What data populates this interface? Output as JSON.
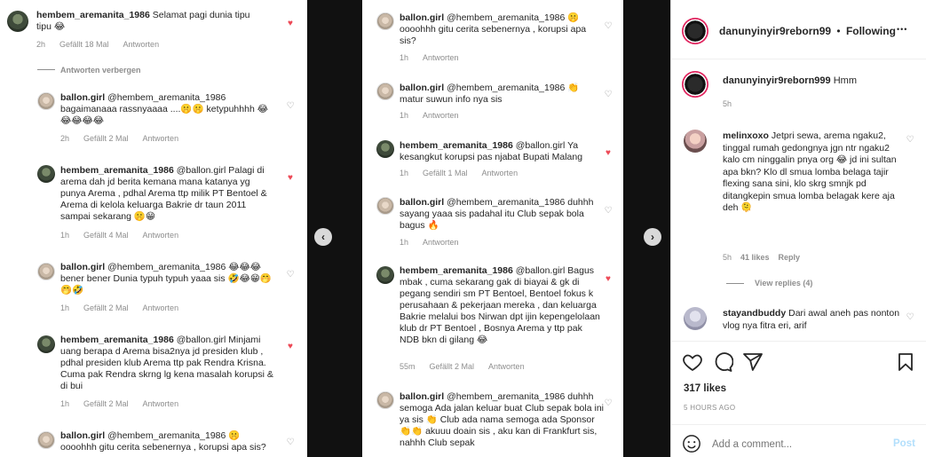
{
  "left": {
    "comments": [
      {
        "user": "hembem_aremanita_1986",
        "text": "Selamat pagi dunia tipu tipu 😂",
        "time": "2h",
        "likes": "Gefällt 18 Mal",
        "reply": "Antworten",
        "liked": true
      },
      {
        "user": "ballon.girl",
        "text": "@hembem_aremanita_1986 bagaimanaaa rassnyaaaa ....🤫🤫 ketypuhhhh 😂😂😂😂😂",
        "time": "2h",
        "likes": "Gefällt 2 Mal",
        "reply": "Antworten",
        "liked": false
      },
      {
        "user": "hembem_aremanita_1986",
        "text": "@ballon.girl Palagi di arema dah jd berita kemana mana katanya yg punya Arema , pdhal Arema ttp milik PT Bentoel & Arema di kelola keluarga Bakrie dr taun 2011 sampai sekarang 🤫😁",
        "time": "1h",
        "likes": "Gefällt 4 Mal",
        "reply": "Antworten",
        "liked": true
      },
      {
        "user": "ballon.girl",
        "text": "@hembem_aremanita_1986 😂😂😂 bener bener Dunia typuh typuh yaaa sis 🤣😂😁🤭🤭🤣",
        "time": "1h",
        "likes": "Gefällt 2 Mal",
        "reply": "Antworten",
        "liked": false
      },
      {
        "user": "hembem_aremanita_1986",
        "text": "@ballon.girl Minjami uang berapa d Arema bisa2nya jd presiden klub , pdhal presiden klub Arema ttp pak Rendra Krisna. Cuma pak Rendra skrng lg kena masalah korupsi & di bui",
        "time": "1h",
        "likes": "Gefällt 2 Mal",
        "reply": "Antworten",
        "liked": true
      },
      {
        "user": "ballon.girl",
        "text": "@hembem_aremanita_1986 🤫 oooohhh gitu cerita sebenernya , korupsi apa sis?",
        "time": "",
        "likes": "",
        "reply": "",
        "liked": false
      }
    ],
    "hide_replies": "Antworten verbergen"
  },
  "middle": {
    "comments": [
      {
        "user": "ballon.girl",
        "text": "@hembem_aremanita_1986 🤫 oooohhh gitu cerita sebenernya , korupsi apa sis?",
        "time": "1h",
        "likes": "",
        "reply": "Antworten",
        "liked": false
      },
      {
        "user": "ballon.girl",
        "text": "@hembem_aremanita_1986 👏 matur suwun info nya sis",
        "time": "1h",
        "likes": "",
        "reply": "Antworten",
        "liked": false
      },
      {
        "user": "hembem_aremanita_1986",
        "text": "@ballon.girl Ya kesangkut korupsi pas njabat Bupati Malang",
        "time": "1h",
        "likes": "Gefällt 1 Mal",
        "reply": "Antworten",
        "liked": true
      },
      {
        "user": "ballon.girl",
        "text": "@hembem_aremanita_1986 duhhh sayang yaaa sis padahal itu Club sepak bola bagus 🔥",
        "time": "1h",
        "likes": "",
        "reply": "Antworten",
        "liked": false
      },
      {
        "user": "hembem_aremanita_1986",
        "text": "@ballon.girl Bagus mbak , cuma sekarang gak di biayai & gk di pegang sendiri sm PT Bentoel, Bentoel fokus k perusahaan & pekerjaan mereka , dan keluarga Bakrie melalui bos Nirwan dpt ijin kepengelolaan klub dr PT Bentoel , Bosnya Arema y ttp pak NDB bkn di gilang 😂",
        "time": "55m",
        "likes": "Gefällt 2 Mal",
        "reply": "Antworten",
        "liked": true
      },
      {
        "user": "ballon.girl",
        "text": "@hembem_aremanita_1986 duhhh semoga Ada jalan keluar buat Club sepak bola ini ya sis 👏 Club ada nama semoga ada Sponsor 👏👏 akuuu doain sis , aku kan di Frankfurt sis, nahhh Club sepak",
        "time": "",
        "likes": "",
        "reply": "",
        "liked": false
      }
    ]
  },
  "right": {
    "header": {
      "username": "danunyinyir9reborn99",
      "dot": "•",
      "follow": "Following",
      "more": "•••"
    },
    "caption": {
      "username": "danunyinyir9reborn999",
      "text": "Hmm",
      "time": "5h"
    },
    "comments": [
      {
        "user": "melinxoxo",
        "text": "Jetpri sewa, arema ngaku2, tinggal rumah gedongnya jgn ntr ngaku2 kalo cm ninggalin pnya org 😂 jd ini sultan apa bkn? Klo dl smua lomba belaga tajir flexing sana sini, klo skrg smnjk pd ditangkepin smua lomba belagak kere aja deh 🫠",
        "time": "5h",
        "likes": "41 likes",
        "reply": "Reply",
        "view_replies": "View replies (4)"
      },
      {
        "user": "stayandbuddy",
        "text": "Dari awal aneh pas nonton vlog nya fitra eri, arif"
      }
    ],
    "likes": "317 likes",
    "posted": "5 HOURS AGO",
    "add_comment": "Add a comment...",
    "post": "Post"
  },
  "nav": {
    "prev": "‹",
    "next": "›"
  }
}
